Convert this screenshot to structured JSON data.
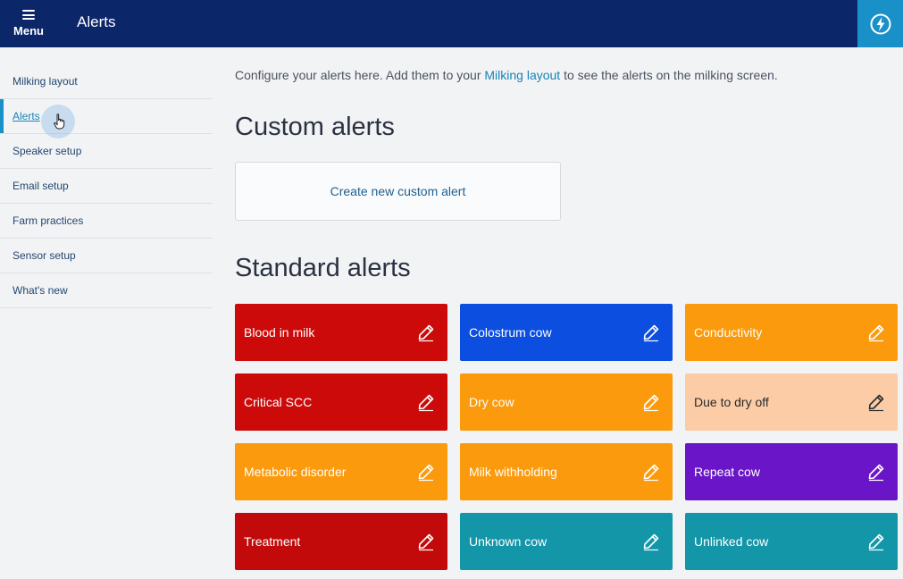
{
  "header": {
    "menu_label": "Menu",
    "title": "Alerts"
  },
  "sidebar": {
    "items": [
      {
        "label": "Milking layout",
        "active": false
      },
      {
        "label": "Alerts",
        "active": true
      },
      {
        "label": "Speaker setup",
        "active": false
      },
      {
        "label": "Email setup",
        "active": false
      },
      {
        "label": "Farm practices",
        "active": false
      },
      {
        "label": "Sensor setup",
        "active": false
      },
      {
        "label": "What's new",
        "active": false
      }
    ]
  },
  "main": {
    "intro_before": "Configure your alerts here. Add them to your ",
    "intro_link": "Milking layout",
    "intro_after": " to see the alerts on the milking screen.",
    "custom_heading": "Custom alerts",
    "create_button": "Create new custom alert",
    "standard_heading": "Standard alerts"
  },
  "alerts": [
    {
      "label": "Blood in milk",
      "color": "#cc0a0a",
      "text_color": "#ffffff"
    },
    {
      "label": "Colostrum cow",
      "color": "#0b4ee0",
      "text_color": "#ffffff"
    },
    {
      "label": "Conductivity",
      "color": "#fb9a0c",
      "text_color": "#ffffff"
    },
    {
      "label": "Critical SCC",
      "color": "#cc0a0a",
      "text_color": "#ffffff"
    },
    {
      "label": "Dry cow",
      "color": "#fb9a0c",
      "text_color": "#ffffff"
    },
    {
      "label": "Due to dry off",
      "color": "#fbcca6",
      "text_color": "#2a2a2a"
    },
    {
      "label": "Metabolic disorder",
      "color": "#fb9a0c",
      "text_color": "#ffffff"
    },
    {
      "label": "Milk withholding",
      "color": "#fb9a0c",
      "text_color": "#ffffff"
    },
    {
      "label": "Repeat cow",
      "color": "#6a16c8",
      "text_color": "#ffffff"
    },
    {
      "label": "Treatment",
      "color": "#c20a0a",
      "text_color": "#ffffff"
    },
    {
      "label": "Unknown cow",
      "color": "#1296a8",
      "text_color": "#ffffff"
    },
    {
      "label": "Unlinked cow",
      "color": "#1296a8",
      "text_color": "#ffffff"
    }
  ],
  "icons": {
    "menu": "hamburger-icon",
    "quick_action": "lightning-icon",
    "edit": "pencil-icon",
    "cursor": "hand-cursor-icon"
  }
}
